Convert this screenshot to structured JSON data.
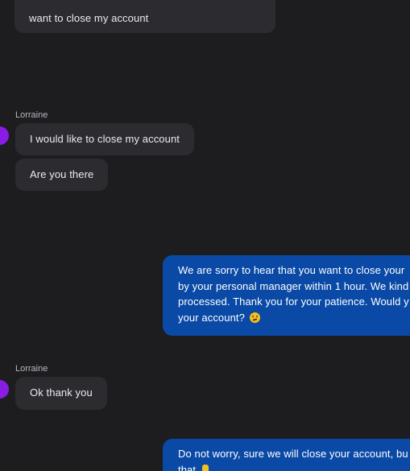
{
  "messages": {
    "top_partial": {
      "line1": "...",
      "line2": "want to close my account"
    },
    "group1": {
      "sender": "Lorraine",
      "msg1": "I would like to close my account",
      "msg2": "Are you there"
    },
    "agent1": {
      "line1": "We are sorry to hear that you want to close your",
      "line2": "by your personal manager within 1 hour. We kind",
      "line3": "processed. Thank you for your patience. Would y",
      "line4": "your account?"
    },
    "group2": {
      "sender": "Lorraine",
      "msg1": "Ok thank you"
    },
    "agent2": {
      "line1": "Do not worry, sure we will close your account, bu",
      "line2": "that"
    }
  },
  "icons": {
    "avatar": "avatar",
    "confused_face": "confused-face-emoji",
    "hand": "folded-hands-emoji"
  },
  "colors": {
    "background": "#1d1d20",
    "incoming_bubble": "#2b2b30",
    "outgoing_bubble": "#0a4aa6",
    "avatar": "#8a1ce6"
  }
}
